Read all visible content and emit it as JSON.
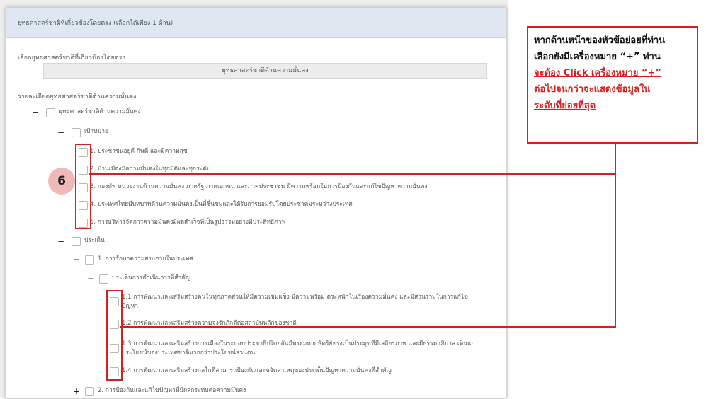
{
  "panel": {
    "title": "ยุทธศาสตร์ชาติที่เกี่ยวข้องโดยตรง (เลือกได้เพียง 1 ด้าน)"
  },
  "select": {
    "label": "เลือกยุทธศาสตร์ชาติที่เกี่ยวข้องโดยตรง",
    "value": "ยุทธศาสตร์ชาติด้านความมั่นคง"
  },
  "detail": {
    "label": "รายละเอียดยุทธศาสตร์ชาติด้านความมั่นคง"
  },
  "tree": {
    "root": {
      "toggle": "−",
      "label": "ยุทธศาสตร์ชาติด้านความมั่นคง"
    },
    "goals": {
      "toggle": "−",
      "label": "เป้าหมาย",
      "items": [
        "1. ประชาชนอยู่ดี กินดี และมีความสุข",
        "2. บ้านเมืองมีความมั่นคงในทุกมิติและทุกระดับ",
        "3. กองทัพ หน่วยงานด้านความมั่นคง ภาครัฐ ภาคเอกชน และภาคประชาชน มีความพร้อมในการป้องกันและแก้ไขปัญหาความมั่นคง",
        "4. ประเทศไทยมีบทบาทด้านความมั่นคงเป็นที่ชื่นชมและได้รับการยอมรับโดยประชาคมระหว่างประเทศ",
        "5. การบริหารจัดการความมั่นคงมีผลสำเร็จที่เป็นรูปธรรมอย่างมีประสิทธิภาพ"
      ]
    },
    "issues": {
      "toggle": "−",
      "label": "ประเด็น"
    },
    "issue1": {
      "toggle": "−",
      "label": "1. การรักษาความสงบภายในประเทศ"
    },
    "sub": {
      "toggle": "−",
      "label": "ประเด็นการดำเนินการที่สำคัญ",
      "items": [
        "1.1 การพัฒนาและเสริมสร้างคนในทุกภาคส่วนให้มีความเข้มแข็ง มีความพร้อม ตระหนักในเรื่องความมั่นคง และมีส่วนร่วมในการแก้ไขปัญหา",
        "1.2 การพัฒนาและเสริมสร้างความจงรักภักดีต่อสถาบันหลักของชาติ",
        "1.3 การพัฒนาและเสริมสร้างการเมืองในระบอบประชาธิปไตยอันมีพระมหากษัตริย์ทรงเป็นประมุขที่มีเสถียรภาพ และมีธรรมาภิบาล เห็นแก่ประโยชน์ของประเทศชาติมากกว่าประโยชน์ส่วนตน",
        "1.4 การพัฒนาและเสริมสร้างกลไกที่สามารถป้องกันและขจัดสาเหตุของประเด็นปัญหาความมั่นคงที่สำคัญ"
      ]
    },
    "issue2": {
      "toggle": "+",
      "label": "2. การป้องกันและแก้ไขปัญหาที่มีผลกระทบต่อความมั่นคง"
    }
  },
  "badge": "6",
  "callout": {
    "line1": "หากด้านหน้าของหัวข้อย่อยที่ท่าน",
    "line2": "เลือกยังมีเครื่องหมาย “+” ท่าน",
    "line3": "จะต้อง Click เครื่องหมาย “+”",
    "line4": "ต่อไปจนกว่าจะแสดงข้อมูลใน",
    "line5": "ระดับที่ย่อยที่สุด"
  },
  "colors": {
    "highlight": "#d42020",
    "header_bg": "#dfe8f0",
    "badge_bg": "#f0b8b8"
  }
}
